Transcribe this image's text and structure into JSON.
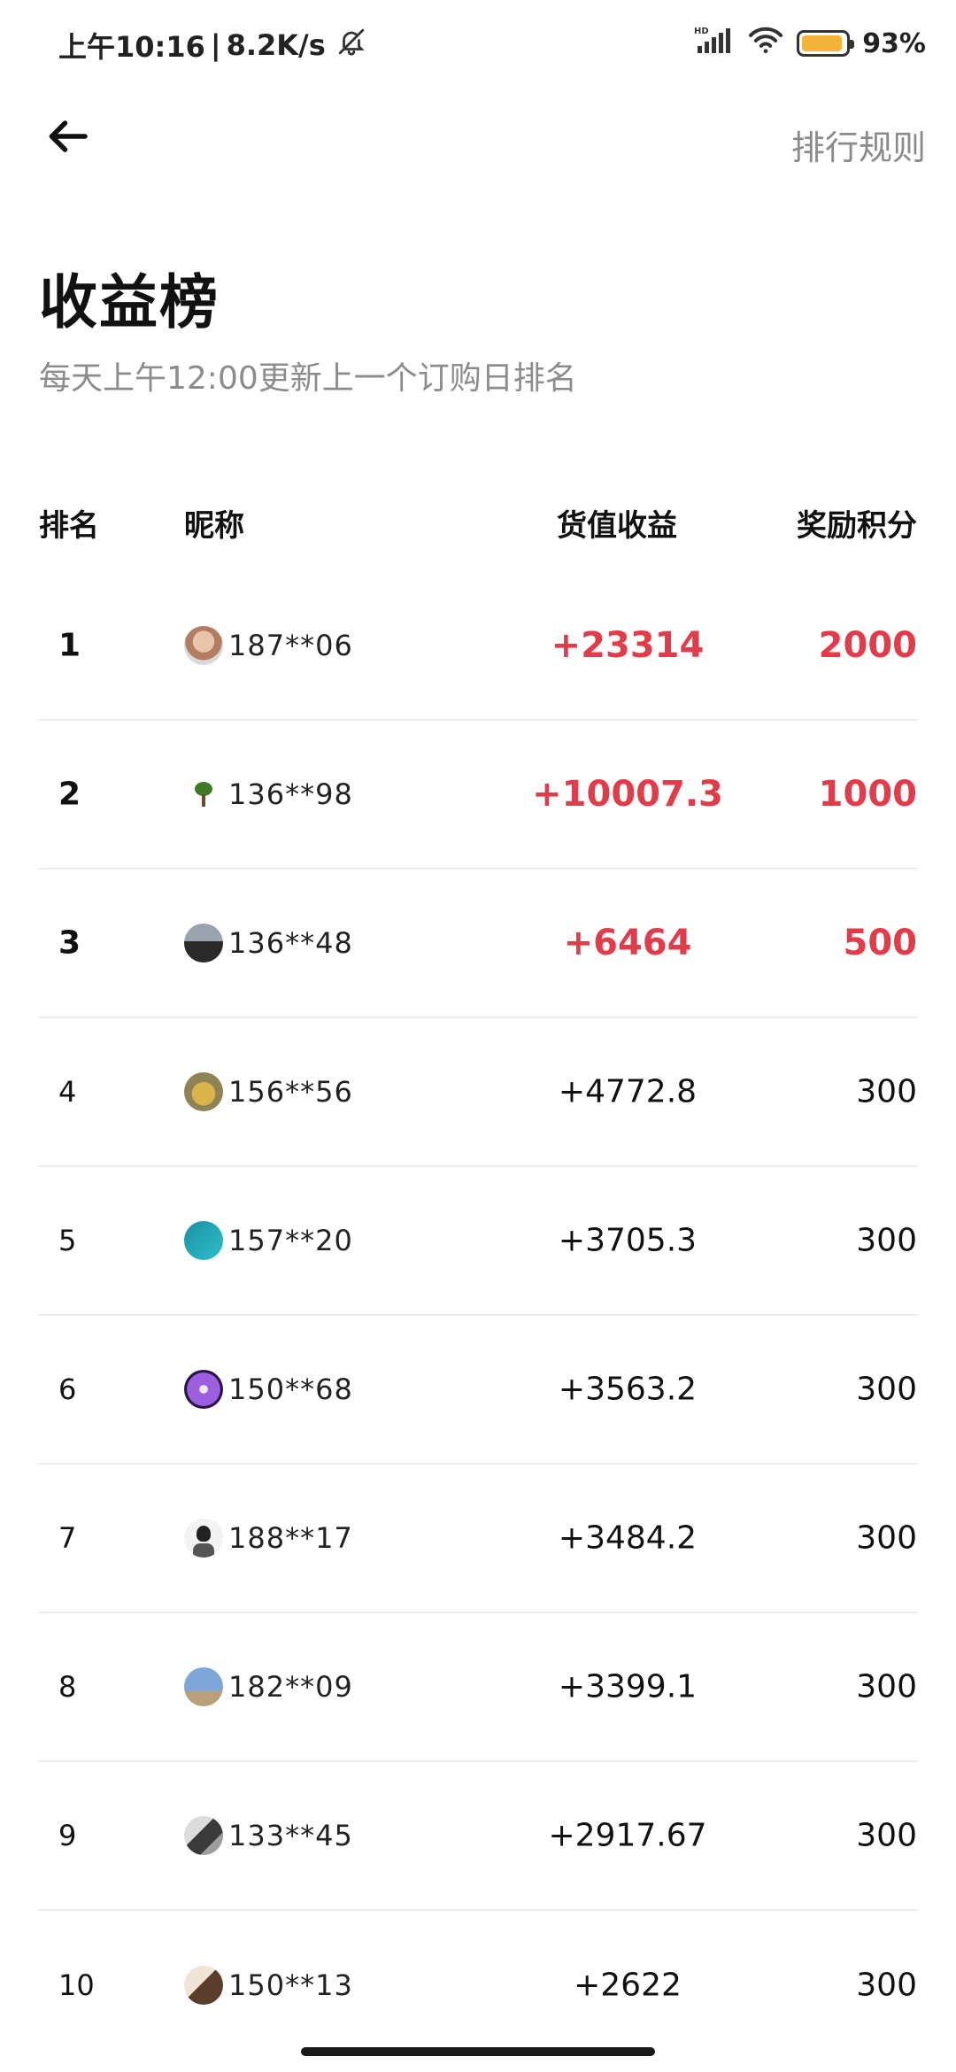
{
  "status_bar": {
    "time": "上午10:16",
    "separator": "|",
    "net_speed": "8.2K/s",
    "network_type": "HD",
    "battery_percent": "93%",
    "battery_level": 0.93,
    "icons": [
      "bell-off-icon",
      "signal-icon",
      "wifi-icon",
      "battery-icon"
    ]
  },
  "nav": {
    "back_icon": "arrow-left-icon",
    "rules_label": "排行规则"
  },
  "page": {
    "title": "收益榜",
    "subtitle": "每天上午12:00更新上一个订购日排名"
  },
  "table": {
    "headers": {
      "rank": "排名",
      "nickname": "昵称",
      "gain": "货值收益",
      "points": "奖励积分"
    },
    "rows": [
      {
        "rank": "1",
        "nickname": "187**06",
        "gain": "+23314",
        "points": "2000"
      },
      {
        "rank": "2",
        "nickname": "136**98",
        "gain": "+10007.3",
        "points": "1000"
      },
      {
        "rank": "3",
        "nickname": "136**48",
        "gain": "+6464",
        "points": "500"
      },
      {
        "rank": "4",
        "nickname": "156**56",
        "gain": "+4772.8",
        "points": "300"
      },
      {
        "rank": "5",
        "nickname": "157**20",
        "gain": "+3705.3",
        "points": "300"
      },
      {
        "rank": "6",
        "nickname": "150**68",
        "gain": "+3563.2",
        "points": "300"
      },
      {
        "rank": "7",
        "nickname": "188**17",
        "gain": "+3484.2",
        "points": "300"
      },
      {
        "rank": "8",
        "nickname": "182**09",
        "gain": "+3399.1",
        "points": "300"
      },
      {
        "rank": "9",
        "nickname": "133**45",
        "gain": "+2917.67",
        "points": "300"
      },
      {
        "rank": "10",
        "nickname": "150**13",
        "gain": "+2622",
        "points": "300"
      }
    ]
  },
  "colors": {
    "highlight": "#e23b4a",
    "muted_text": "#8c8c8c",
    "divider": "#ececec",
    "battery": "#f4b43a"
  }
}
